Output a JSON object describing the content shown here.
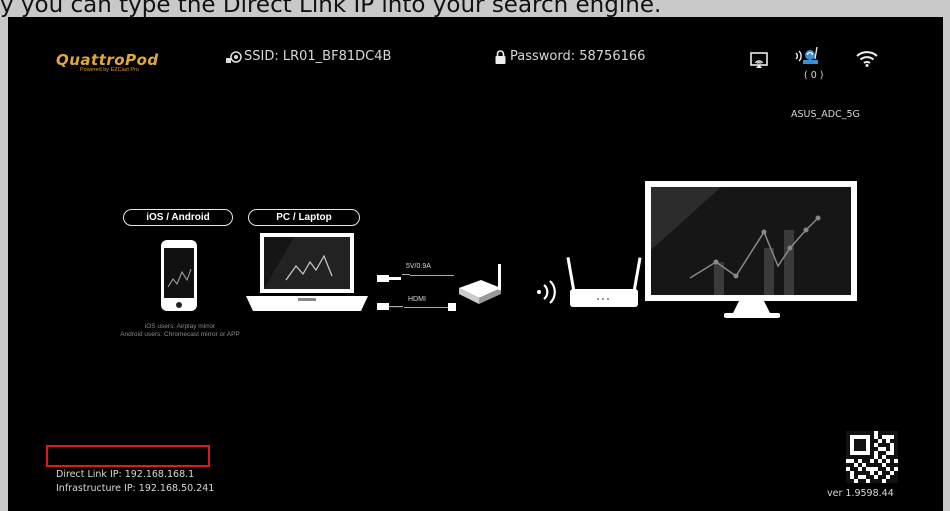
{
  "caption": "y you can type the Direct Link IP into your search engine.",
  "header": {
    "logo": "QuattroPod",
    "logo_sub": "Powered by EZCast Pro",
    "ssid": "SSID: LR01_BF81DC4B",
    "password": "Password: 58756166",
    "router_count": "( 0 )",
    "wifi_name": "ASUS_ADC_5G"
  },
  "diagram": {
    "ios_label": "iOS / Android",
    "pc_label": "PC / Laptop",
    "power_label": "5V/0.9A",
    "hdmi_label": "HDMI",
    "note_line1": "iOS users: Airplay mirror",
    "note_line2": "Android users: Chromecast mirror or APP"
  },
  "footer": {
    "direct_link": "Direct Link IP: 192.168.168.1",
    "infrastructure": "Infrastructure IP: 192.168.50.241",
    "version": "ver 1.9598.44"
  },
  "colors": {
    "logo": "#e0a83c",
    "highlight": "#e0191c",
    "router_icon": "#3a8fd6"
  }
}
